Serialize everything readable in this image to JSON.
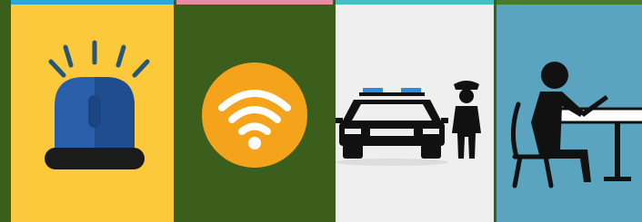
{
  "tiles": [
    {
      "icon": "siren-light-icon",
      "background": "#fcc93d",
      "accent_bar": "#2ba6dc"
    },
    {
      "icon": "wifi-icon",
      "background": "#3c5e1c",
      "accent_bar": "#e88aa4"
    },
    {
      "icon": "police-car-officer-icon",
      "background": "#efefef",
      "accent_bar": "#3fc1c4"
    },
    {
      "icon": "person-writing-at-desk-icon",
      "background": "#5ba4bf",
      "accent_bar": "#4a7a2c"
    }
  ],
  "colors": {
    "page_background": "#3c5e1c",
    "siren_blue": "#2a5ea8",
    "siren_dark": "#1b1b1b",
    "wifi_orange": "#f6a31c",
    "wifi_white": "#ffffff",
    "police_black": "#111111",
    "police_blue": "#2b8ce0",
    "writer_black": "#111111",
    "desk_white": "#ffffff"
  }
}
